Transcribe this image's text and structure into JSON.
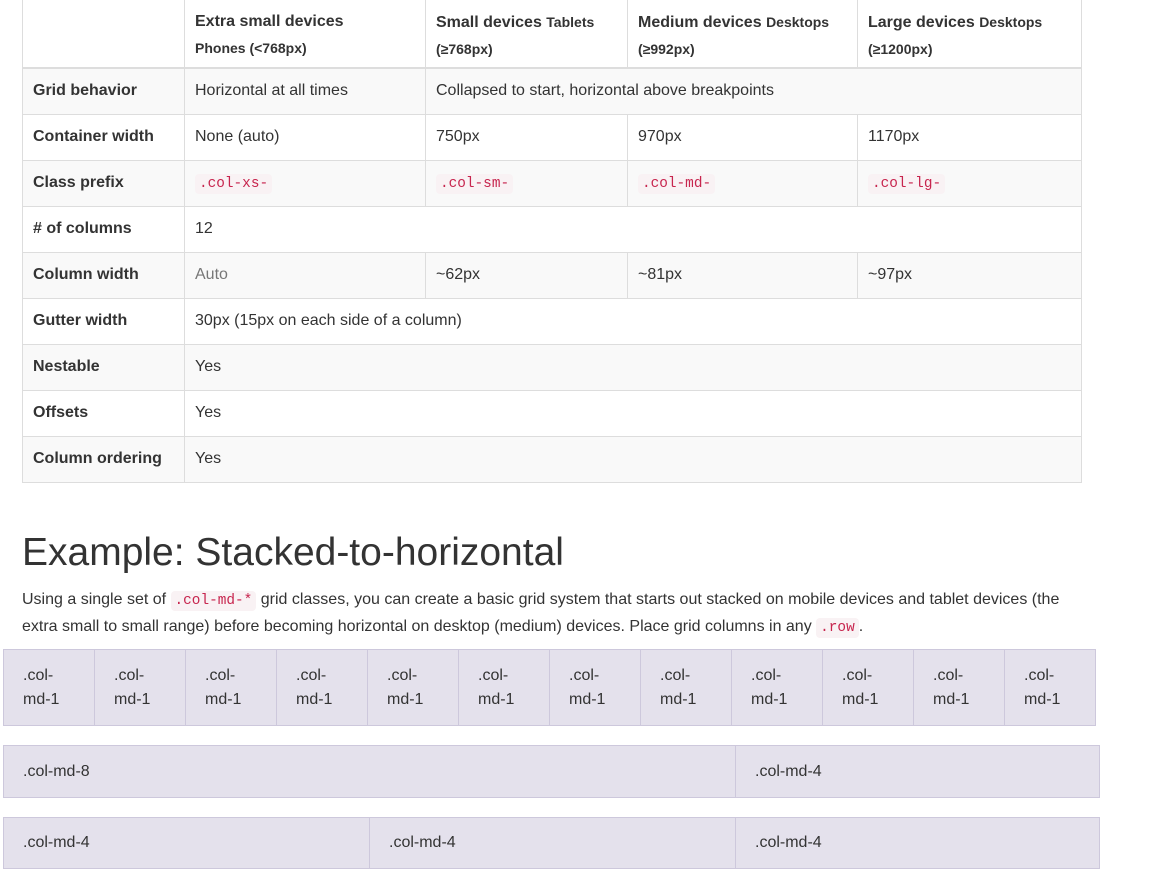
{
  "table": {
    "headers": [
      {
        "main": "",
        "sub": ""
      },
      {
        "main": "Extra small devices",
        "sub": "Phones (<768px)"
      },
      {
        "main": "Small devices",
        "tail": "Tablets",
        "sub": "(≥768px)"
      },
      {
        "main": "Medium devices",
        "tail": "Desktops",
        "sub": "(≥992px)"
      },
      {
        "main": "Large devices",
        "tail": "Desktops",
        "sub": "(≥1200px)"
      }
    ],
    "rows": [
      {
        "label": "Grid behavior",
        "cells": [
          "Horizontal at all times",
          "Collapsed to start, horizontal above breakpoints"
        ]
      },
      {
        "label": "Container width",
        "cells": [
          "None (auto)",
          "750px",
          "970px",
          "1170px"
        ]
      },
      {
        "label": "Class prefix",
        "cells": [
          ".col-xs-",
          ".col-sm-",
          ".col-md-",
          ".col-lg-"
        ]
      },
      {
        "label": "# of columns",
        "cells": [
          "12"
        ]
      },
      {
        "label": "Column width",
        "cells": [
          "Auto",
          "~62px",
          "~81px",
          "~97px"
        ]
      },
      {
        "label": "Gutter width",
        "cells": [
          "30px (15px on each side of a column)"
        ]
      },
      {
        "label": "Nestable",
        "cells": [
          "Yes"
        ]
      },
      {
        "label": "Offsets",
        "cells": [
          "Yes"
        ]
      },
      {
        "label": "Column ordering",
        "cells": [
          "Yes"
        ]
      }
    ]
  },
  "example": {
    "title": "Example: Stacked-to-horizontal",
    "intro_before": "Using a single set of ",
    "intro_code1": ".col-md-*",
    "intro_middle": " grid classes, you can create a basic grid system that starts out stacked on mobile devices and tablet devices (the extra small to small range) before becoming horizontal on desktop (medium) devices. Place grid columns in any ",
    "intro_code2": ".row",
    "intro_after": ".",
    "rows": [
      [
        ".col-md-1",
        ".col-md-1",
        ".col-md-1",
        ".col-md-1",
        ".col-md-1",
        ".col-md-1",
        ".col-md-1",
        ".col-md-1",
        ".col-md-1",
        ".col-md-1",
        ".col-md-1",
        ".col-md-1"
      ],
      [
        ".col-md-8",
        ".col-md-4"
      ],
      [
        ".col-md-4",
        ".col-md-4",
        ".col-md-4"
      ]
    ]
  }
}
